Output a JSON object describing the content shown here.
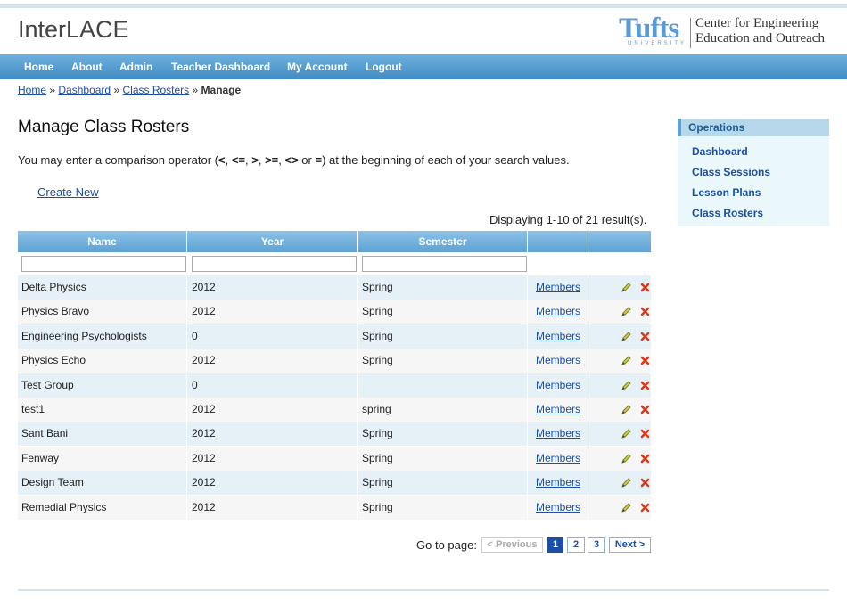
{
  "app": {
    "title": "InterLACE",
    "logo": {
      "tufts": "Tufts",
      "university": "UNIVERSITY",
      "line1": "Center for Engineering",
      "line2": "Education and Outreach"
    }
  },
  "nav": {
    "items": [
      "Home",
      "About",
      "Admin",
      "Teacher Dashboard",
      "My Account",
      "Logout"
    ]
  },
  "breadcrumb": {
    "home": "Home",
    "dashboard": "Dashboard",
    "class_rosters": "Class Rosters",
    "sep": "»",
    "current": "Manage"
  },
  "page": {
    "title": "Manage Class Rosters",
    "intro_prefix": "You may enter a comparison operator (",
    "operators": [
      "<",
      "<=",
      ">",
      ">=",
      "<>",
      "="
    ],
    "intro_suffix": ") at the beginning of each of your search values.",
    "create_new": "Create New",
    "summary": "Displaying 1-10 of 21 result(s)."
  },
  "table": {
    "columns": [
      "Name",
      "Year",
      "Semester",
      "",
      ""
    ],
    "filters": {
      "name": "",
      "year": "",
      "semester": ""
    },
    "members_label": "Members",
    "rows": [
      {
        "name": "Delta Physics",
        "year": "2012",
        "semester": "Spring"
      },
      {
        "name": "Physics Bravo",
        "year": "2012",
        "semester": "Spring"
      },
      {
        "name": "Engineering Psychologists",
        "year": "0",
        "semester": "Spring"
      },
      {
        "name": "Physics Echo",
        "year": "2012",
        "semester": "Spring"
      },
      {
        "name": "Test Group",
        "year": "0",
        "semester": ""
      },
      {
        "name": "test1",
        "year": "2012",
        "semester": "spring"
      },
      {
        "name": "Sant Bani",
        "year": "2012",
        "semester": "Spring"
      },
      {
        "name": "Fenway",
        "year": "2012",
        "semester": "Spring"
      },
      {
        "name": "Design Team",
        "year": "2012",
        "semester": "Spring"
      },
      {
        "name": "Remedial Physics",
        "year": "2012",
        "semester": "Spring"
      }
    ],
    "icons": {
      "edit": "pencil-icon",
      "delete": "delete-x-icon"
    }
  },
  "pager": {
    "label": "Go to page:",
    "previous": "< Previous",
    "pages": [
      "1",
      "2",
      "3"
    ],
    "current_page": "1",
    "next": "Next >"
  },
  "sidebar": {
    "heading": "Operations",
    "links": [
      "Dashboard",
      "Class Sessions",
      "Lesson Plans",
      "Class Rosters"
    ]
  },
  "colors": {
    "nav": "#3f8cc4",
    "table_header": "#5ea2d4",
    "row_alt": "#e6f0f7",
    "link": "#1a4fa3",
    "sidebar_bg": "#eaf8fc"
  }
}
